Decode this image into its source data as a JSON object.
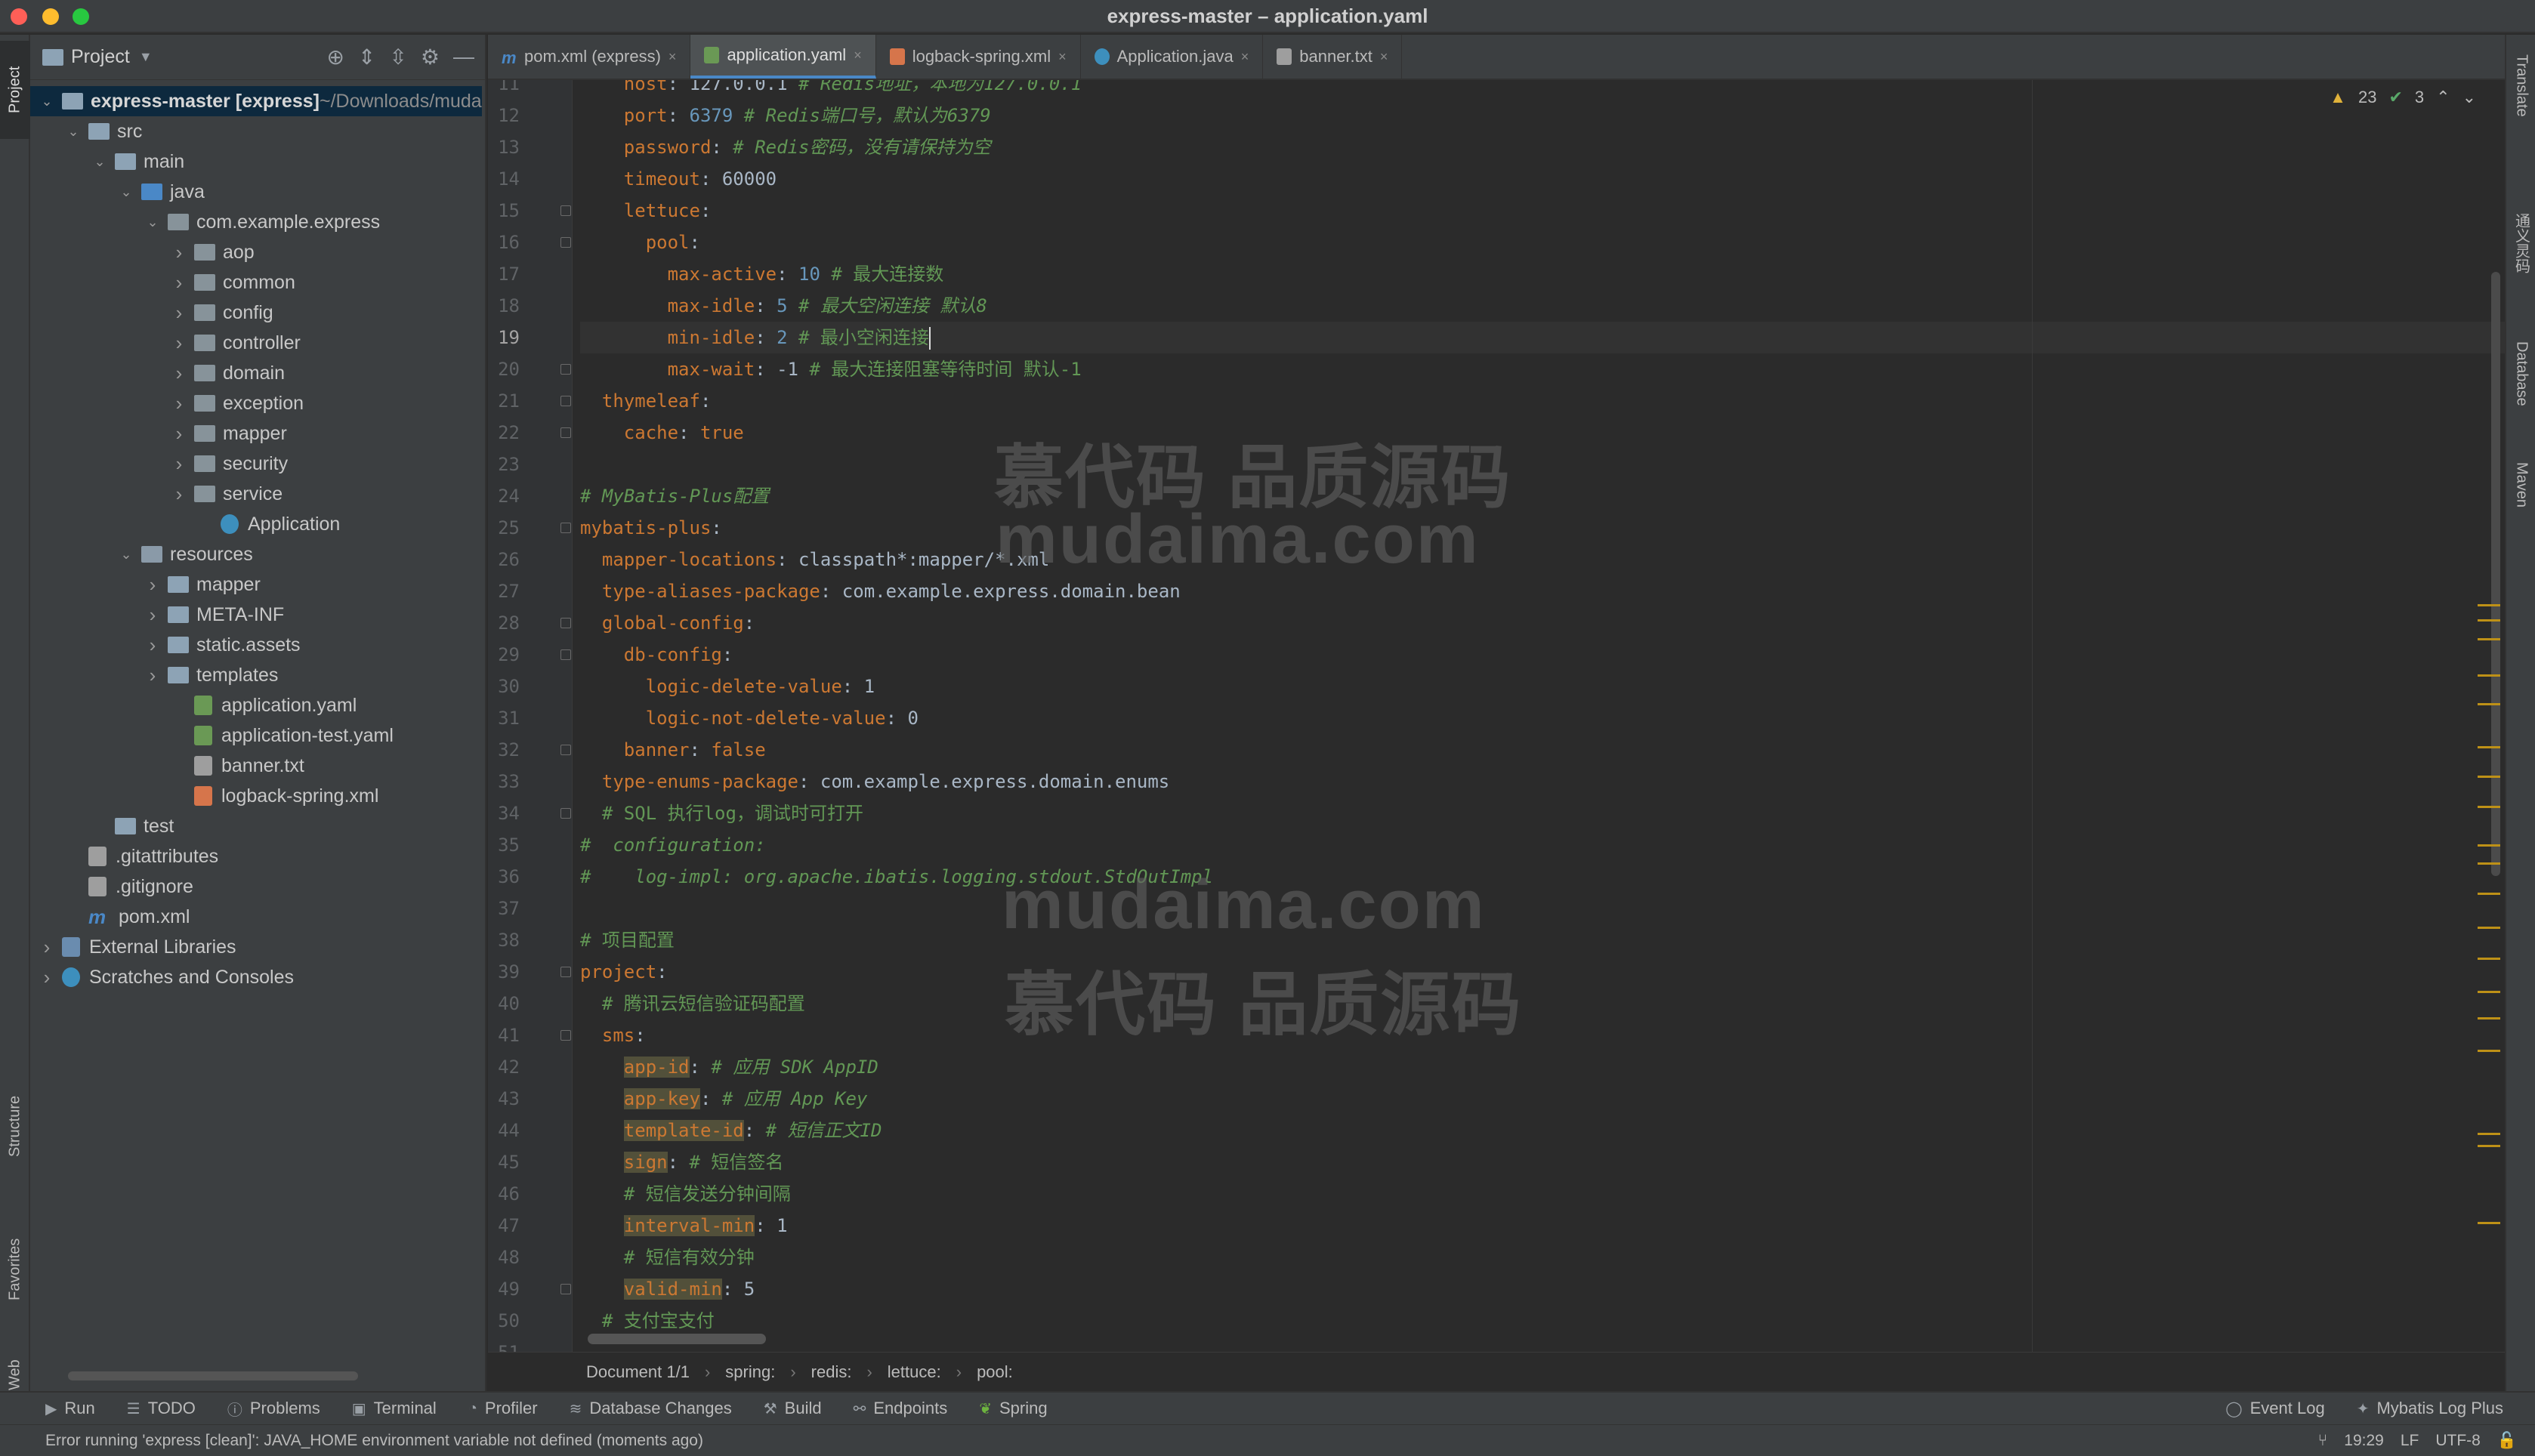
{
  "window": {
    "title": "express-master – application.yaml"
  },
  "left_strip": {
    "project": "Project",
    "structure": "Structure",
    "favorites": "Favorites",
    "web": "Web"
  },
  "right_strip": {
    "translate": "Translate",
    "fanyi": "通义灵码",
    "database": "Database",
    "maven": "Maven"
  },
  "project_panel": {
    "title": "Project",
    "tree": [
      {
        "label": "express-master [express]",
        "suffix": " ~/Downloads/muda",
        "indent": 0,
        "arrow": "down",
        "icon": "folder"
      },
      {
        "label": "src",
        "indent": 1,
        "arrow": "down",
        "icon": "folder"
      },
      {
        "label": "main",
        "indent": 2,
        "arrow": "down",
        "icon": "folder"
      },
      {
        "label": "java",
        "indent": 3,
        "arrow": "down",
        "icon": "java"
      },
      {
        "label": "com.example.express",
        "indent": 4,
        "arrow": "down",
        "icon": "pkg"
      },
      {
        "label": "aop",
        "indent": 5,
        "arrow": "right",
        "icon": "pkg"
      },
      {
        "label": "common",
        "indent": 5,
        "arrow": "right",
        "icon": "pkg"
      },
      {
        "label": "config",
        "indent": 5,
        "arrow": "right",
        "icon": "pkg"
      },
      {
        "label": "controller",
        "indent": 5,
        "arrow": "right",
        "icon": "pkg"
      },
      {
        "label": "domain",
        "indent": 5,
        "arrow": "right",
        "icon": "pkg"
      },
      {
        "label": "exception",
        "indent": 5,
        "arrow": "right",
        "icon": "pkg"
      },
      {
        "label": "mapper",
        "indent": 5,
        "arrow": "right",
        "icon": "pkg"
      },
      {
        "label": "security",
        "indent": 5,
        "arrow": "right",
        "icon": "pkg"
      },
      {
        "label": "service",
        "indent": 5,
        "arrow": "right",
        "icon": "pkg"
      },
      {
        "label": "Application",
        "indent": 6,
        "arrow": "",
        "icon": "app"
      },
      {
        "label": "resources",
        "indent": 3,
        "arrow": "down",
        "icon": "res"
      },
      {
        "label": "mapper",
        "indent": 4,
        "arrow": "right",
        "icon": "folder"
      },
      {
        "label": "META-INF",
        "indent": 4,
        "arrow": "right",
        "icon": "folder"
      },
      {
        "label": "static.assets",
        "indent": 4,
        "arrow": "right",
        "icon": "folder"
      },
      {
        "label": "templates",
        "indent": 4,
        "arrow": "right",
        "icon": "folder"
      },
      {
        "label": "application.yaml",
        "indent": 5,
        "arrow": "",
        "icon": "yaml"
      },
      {
        "label": "application-test.yaml",
        "indent": 5,
        "arrow": "",
        "icon": "yaml"
      },
      {
        "label": "banner.txt",
        "indent": 5,
        "arrow": "",
        "icon": "txt"
      },
      {
        "label": "logback-spring.xml",
        "indent": 5,
        "arrow": "",
        "icon": "xml"
      },
      {
        "label": "test",
        "indent": 2,
        "arrow": "",
        "icon": "folder"
      },
      {
        "label": ".gitattributes",
        "indent": 1,
        "arrow": "",
        "icon": "txt"
      },
      {
        "label": ".gitignore",
        "indent": 1,
        "arrow": "",
        "icon": "txt"
      },
      {
        "label": "pom.xml",
        "indent": 1,
        "arrow": "",
        "icon": "m"
      },
      {
        "label": "External Libraries",
        "indent": 0,
        "arrow": "right",
        "icon": "lib"
      },
      {
        "label": "Scratches and Consoles",
        "indent": 0,
        "arrow": "right",
        "icon": "app"
      }
    ]
  },
  "tabs": [
    {
      "label": "pom.xml (express)",
      "icon": "m",
      "active": false
    },
    {
      "label": "application.yaml",
      "icon": "yaml",
      "active": true
    },
    {
      "label": "logback-spring.xml",
      "icon": "xml",
      "active": false
    },
    {
      "label": "Application.java",
      "icon": "app",
      "active": false
    },
    {
      "label": "banner.txt",
      "icon": "txt",
      "active": false
    }
  ],
  "inspection": {
    "warnings": "23",
    "ok": "3"
  },
  "editor": {
    "current_line": 19,
    "lines": [
      {
        "n": 11,
        "segs": [
          [
            "key",
            "    host"
          ],
          [
            "val",
            ": 127.0.0.1 "
          ],
          [
            "cmt",
            "# Redis地址，本地为127.0.0.1"
          ]
        ]
      },
      {
        "n": 12,
        "segs": [
          [
            "key",
            "    port"
          ],
          [
            "val",
            ": "
          ],
          [
            "num",
            "6379"
          ],
          [
            "cmt",
            " # Redis端口号，默认为6379"
          ]
        ]
      },
      {
        "n": 13,
        "segs": [
          [
            "key",
            "    password"
          ],
          [
            "val",
            ": "
          ],
          [
            "cmt",
            "# Redis密码，没有请保持为空"
          ]
        ]
      },
      {
        "n": 14,
        "segs": [
          [
            "key",
            "    timeout"
          ],
          [
            "val",
            ": 60000"
          ]
        ]
      },
      {
        "n": 15,
        "segs": [
          [
            "key",
            "    lettuce"
          ],
          [
            "val",
            ":"
          ]
        ]
      },
      {
        "n": 16,
        "segs": [
          [
            "key",
            "      pool"
          ],
          [
            "val",
            ":"
          ]
        ]
      },
      {
        "n": 17,
        "segs": [
          [
            "key",
            "        max-active"
          ],
          [
            "val",
            ": "
          ],
          [
            "num",
            "10"
          ],
          [
            "cmtc",
            " # 最大连接数"
          ]
        ]
      },
      {
        "n": 18,
        "segs": [
          [
            "key",
            "        max-idle"
          ],
          [
            "val",
            ": "
          ],
          [
            "num",
            "5"
          ],
          [
            "cmt",
            " # 最大空闲连接 默认8"
          ]
        ]
      },
      {
        "n": 19,
        "segs": [
          [
            "key",
            "        min-idle"
          ],
          [
            "val",
            ": "
          ],
          [
            "num",
            "2"
          ],
          [
            "cmtc",
            " # 最小空闲连接"
          ]
        ],
        "caret": true
      },
      {
        "n": 20,
        "segs": [
          [
            "key",
            "        max-wait"
          ],
          [
            "val",
            ": -1 "
          ],
          [
            "cmtc",
            "# 最大连接阻塞等待时间 默认-1"
          ]
        ]
      },
      {
        "n": 21,
        "segs": [
          [
            "key",
            "  thymeleaf"
          ],
          [
            "val",
            ":"
          ]
        ]
      },
      {
        "n": 22,
        "segs": [
          [
            "key",
            "    cache"
          ],
          [
            "val",
            ": "
          ],
          [
            "key",
            "true"
          ]
        ]
      },
      {
        "n": 23,
        "segs": []
      },
      {
        "n": 24,
        "segs": [
          [
            "cmt",
            "# MyBatis-Plus配置"
          ]
        ]
      },
      {
        "n": 25,
        "segs": [
          [
            "key",
            "mybatis-plus"
          ],
          [
            "val",
            ":"
          ]
        ]
      },
      {
        "n": 26,
        "segs": [
          [
            "key",
            "  mapper-locations"
          ],
          [
            "val",
            ": classpath*:mapper/*.xml"
          ]
        ]
      },
      {
        "n": 27,
        "segs": [
          [
            "key",
            "  type-aliases-package"
          ],
          [
            "val",
            ": com.example.express.domain.bean"
          ]
        ]
      },
      {
        "n": 28,
        "segs": [
          [
            "key",
            "  global-config"
          ],
          [
            "val",
            ":"
          ]
        ]
      },
      {
        "n": 29,
        "segs": [
          [
            "key",
            "    db-config"
          ],
          [
            "val",
            ":"
          ]
        ]
      },
      {
        "n": 30,
        "segs": [
          [
            "key",
            "      logic-delete-value"
          ],
          [
            "val",
            ": 1"
          ]
        ]
      },
      {
        "n": 31,
        "segs": [
          [
            "key",
            "      logic-not-delete-value"
          ],
          [
            "val",
            ": 0"
          ]
        ]
      },
      {
        "n": 32,
        "segs": [
          [
            "key",
            "    banner"
          ],
          [
            "val",
            ": "
          ],
          [
            "key",
            "false"
          ]
        ]
      },
      {
        "n": 33,
        "segs": [
          [
            "key",
            "  type-enums-package"
          ],
          [
            "val",
            ": com.example.express.domain.enums"
          ]
        ]
      },
      {
        "n": 34,
        "segs": [
          [
            "cmtc",
            "  # SQL 执行log，调试时可打开"
          ]
        ]
      },
      {
        "n": 35,
        "segs": [
          [
            "cmt",
            "#  configuration:"
          ]
        ]
      },
      {
        "n": 36,
        "segs": [
          [
            "cmt",
            "#    log-impl: org.apache.ibatis.logging.stdout.StdOutImpl"
          ]
        ]
      },
      {
        "n": 37,
        "segs": []
      },
      {
        "n": 38,
        "segs": [
          [
            "cmtc",
            "# 项目配置"
          ]
        ]
      },
      {
        "n": 39,
        "segs": [
          [
            "key",
            "project"
          ],
          [
            "val",
            ":"
          ]
        ]
      },
      {
        "n": 40,
        "segs": [
          [
            "cmtc",
            "  # 腾讯云短信验证码配置"
          ]
        ]
      },
      {
        "n": 41,
        "segs": [
          [
            "key",
            "  sms"
          ],
          [
            "val",
            ":"
          ]
        ]
      },
      {
        "n": 42,
        "segs": [
          [
            "val",
            "    "
          ],
          [
            "hlkey",
            "app-id"
          ],
          [
            "val",
            ": "
          ],
          [
            "cmt",
            "# 应用 SDK AppID"
          ]
        ]
      },
      {
        "n": 43,
        "segs": [
          [
            "val",
            "    "
          ],
          [
            "hlkey",
            "app-key"
          ],
          [
            "val",
            ": "
          ],
          [
            "cmt",
            "# 应用 App Key"
          ]
        ]
      },
      {
        "n": 44,
        "segs": [
          [
            "val",
            "    "
          ],
          [
            "hlkey",
            "template-id"
          ],
          [
            "val",
            ": "
          ],
          [
            "cmt",
            "# 短信正文ID"
          ]
        ]
      },
      {
        "n": 45,
        "segs": [
          [
            "val",
            "    "
          ],
          [
            "hlkey",
            "sign"
          ],
          [
            "val",
            ": "
          ],
          [
            "cmtc",
            "# 短信签名"
          ]
        ]
      },
      {
        "n": 46,
        "segs": [
          [
            "cmtc",
            "    # 短信发送分钟间隔"
          ]
        ]
      },
      {
        "n": 47,
        "segs": [
          [
            "val",
            "    "
          ],
          [
            "hlkey",
            "interval-min"
          ],
          [
            "val",
            ": 1"
          ]
        ]
      },
      {
        "n": 48,
        "segs": [
          [
            "cmtc",
            "    # 短信有效分钟"
          ]
        ]
      },
      {
        "n": 49,
        "segs": [
          [
            "val",
            "    "
          ],
          [
            "hlkey",
            "valid-min"
          ],
          [
            "val",
            ": 5"
          ]
        ]
      },
      {
        "n": 50,
        "segs": [
          [
            "cmtc",
            "  # 支付宝支付"
          ]
        ]
      },
      {
        "n": 51,
        "segs": []
      }
    ]
  },
  "watermarks": [
    "慕代码 品质源码",
    "mudaima.com",
    "mudaima.com",
    "慕代码 品质源码"
  ],
  "breadcrumb": [
    "Document 1/1",
    "spring:",
    "redis:",
    "lettuce:",
    "pool:"
  ],
  "bottom_tools": {
    "run": "Run",
    "todo": "TODO",
    "problems": "Problems",
    "terminal": "Terminal",
    "profiler": "Profiler",
    "db_changes": "Database Changes",
    "build": "Build",
    "endpoints": "Endpoints",
    "spring": "Spring",
    "event_log": "Event Log",
    "mybatis_log": "Mybatis Log Plus"
  },
  "status": {
    "message": "Error running 'express [clean]': JAVA_HOME environment variable not defined (moments ago)",
    "position": "19:29",
    "line_sep": "LF",
    "encoding": "UTF-8"
  },
  "colors": {
    "bg": "#2b2b2b",
    "panel": "#3c3f41",
    "key": "#cc7832",
    "comment": "#629755",
    "number": "#6897bb"
  }
}
